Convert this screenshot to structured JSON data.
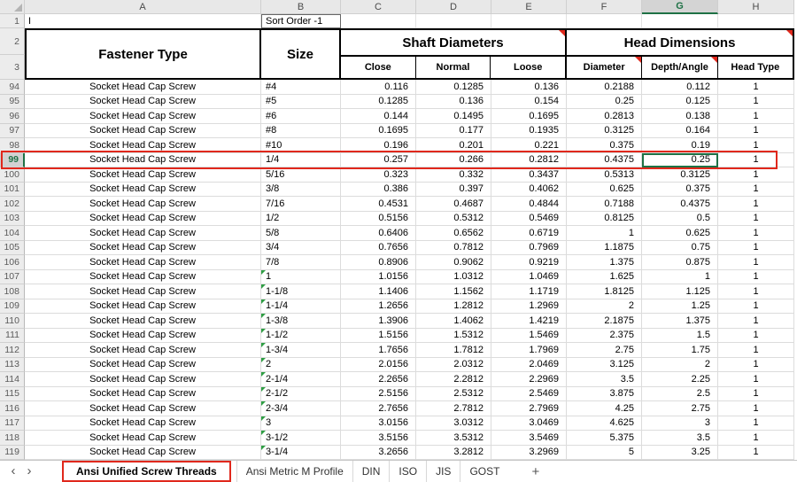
{
  "colors": {
    "selection_green": "#1e7145",
    "annotation_red": "#e0281c",
    "error_flag_green": "#2f9e44",
    "header_gray": "#e8e8e8"
  },
  "sheet": {
    "col_letters": [
      "A",
      "B",
      "C",
      "D",
      "E",
      "F",
      "G",
      "H"
    ],
    "row_numbers": {
      "r1": "1",
      "r2": "2",
      "r3": "3"
    },
    "row1": {
      "a1": "I",
      "b1": "Sort Order -1"
    },
    "headers": {
      "fastener_type": "Fastener Type",
      "size": "Size",
      "shaft": "Shaft Diameters",
      "head": "Head Dimensions",
      "close": "Close",
      "normal": "Normal",
      "loose": "Loose",
      "diameter": "Diameter",
      "depth": "Depth/Angle",
      "head_type": "Head Type"
    },
    "selection": {
      "row": 99,
      "column_letter": "G"
    },
    "rows": [
      {
        "n": 94,
        "type": "Socket Head Cap Screw",
        "size": "#4",
        "close": "0.116",
        "normal": "0.1285",
        "loose": "0.136",
        "diameter": "0.2188",
        "depth": "0.112",
        "head_type": "1",
        "flag": false
      },
      {
        "n": 95,
        "type": "Socket Head Cap Screw",
        "size": "#5",
        "close": "0.1285",
        "normal": "0.136",
        "loose": "0.154",
        "diameter": "0.25",
        "depth": "0.125",
        "head_type": "1",
        "flag": false
      },
      {
        "n": 96,
        "type": "Socket Head Cap Screw",
        "size": "#6",
        "close": "0.144",
        "normal": "0.1495",
        "loose": "0.1695",
        "diameter": "0.2813",
        "depth": "0.138",
        "head_type": "1",
        "flag": false
      },
      {
        "n": 97,
        "type": "Socket Head Cap Screw",
        "size": "#8",
        "close": "0.1695",
        "normal": "0.177",
        "loose": "0.1935",
        "diameter": "0.3125",
        "depth": "0.164",
        "head_type": "1",
        "flag": false
      },
      {
        "n": 98,
        "type": "Socket Head Cap Screw",
        "size": "#10",
        "close": "0.196",
        "normal": "0.201",
        "loose": "0.221",
        "diameter": "0.375",
        "depth": "0.19",
        "head_type": "1",
        "flag": false
      },
      {
        "n": 99,
        "type": "Socket Head Cap Screw",
        "size": "1/4",
        "close": "0.257",
        "normal": "0.266",
        "loose": "0.2812",
        "diameter": "0.4375",
        "depth": "0.25",
        "head_type": "1",
        "flag": false
      },
      {
        "n": 100,
        "type": "Socket Head Cap Screw",
        "size": "5/16",
        "close": "0.323",
        "normal": "0.332",
        "loose": "0.3437",
        "diameter": "0.5313",
        "depth": "0.3125",
        "head_type": "1",
        "flag": false
      },
      {
        "n": 101,
        "type": "Socket Head Cap Screw",
        "size": "3/8",
        "close": "0.386",
        "normal": "0.397",
        "loose": "0.4062",
        "diameter": "0.625",
        "depth": "0.375",
        "head_type": "1",
        "flag": false
      },
      {
        "n": 102,
        "type": "Socket Head Cap Screw",
        "size": "7/16",
        "close": "0.4531",
        "normal": "0.4687",
        "loose": "0.4844",
        "diameter": "0.7188",
        "depth": "0.4375",
        "head_type": "1",
        "flag": false
      },
      {
        "n": 103,
        "type": "Socket Head Cap Screw",
        "size": "1/2",
        "close": "0.5156",
        "normal": "0.5312",
        "loose": "0.5469",
        "diameter": "0.8125",
        "depth": "0.5",
        "head_type": "1",
        "flag": false
      },
      {
        "n": 104,
        "type": "Socket Head Cap Screw",
        "size": "5/8",
        "close": "0.6406",
        "normal": "0.6562",
        "loose": "0.6719",
        "diameter": "1",
        "depth": "0.625",
        "head_type": "1",
        "flag": false
      },
      {
        "n": 105,
        "type": "Socket Head Cap Screw",
        "size": "3/4",
        "close": "0.7656",
        "normal": "0.7812",
        "loose": "0.7969",
        "diameter": "1.1875",
        "depth": "0.75",
        "head_type": "1",
        "flag": false
      },
      {
        "n": 106,
        "type": "Socket Head Cap Screw",
        "size": "7/8",
        "close": "0.8906",
        "normal": "0.9062",
        "loose": "0.9219",
        "diameter": "1.375",
        "depth": "0.875",
        "head_type": "1",
        "flag": false
      },
      {
        "n": 107,
        "type": "Socket Head Cap Screw",
        "size": "1",
        "close": "1.0156",
        "normal": "1.0312",
        "loose": "1.0469",
        "diameter": "1.625",
        "depth": "1",
        "head_type": "1",
        "flag": true
      },
      {
        "n": 108,
        "type": "Socket Head Cap Screw",
        "size": "1-1/8",
        "close": "1.1406",
        "normal": "1.1562",
        "loose": "1.1719",
        "diameter": "1.8125",
        "depth": "1.125",
        "head_type": "1",
        "flag": true
      },
      {
        "n": 109,
        "type": "Socket Head Cap Screw",
        "size": "1-1/4",
        "close": "1.2656",
        "normal": "1.2812",
        "loose": "1.2969",
        "diameter": "2",
        "depth": "1.25",
        "head_type": "1",
        "flag": true
      },
      {
        "n": 110,
        "type": "Socket Head Cap Screw",
        "size": "1-3/8",
        "close": "1.3906",
        "normal": "1.4062",
        "loose": "1.4219",
        "diameter": "2.1875",
        "depth": "1.375",
        "head_type": "1",
        "flag": true
      },
      {
        "n": 111,
        "type": "Socket Head Cap Screw",
        "size": "1-1/2",
        "close": "1.5156",
        "normal": "1.5312",
        "loose": "1.5469",
        "diameter": "2.375",
        "depth": "1.5",
        "head_type": "1",
        "flag": true
      },
      {
        "n": 112,
        "type": "Socket Head Cap Screw",
        "size": "1-3/4",
        "close": "1.7656",
        "normal": "1.7812",
        "loose": "1.7969",
        "diameter": "2.75",
        "depth": "1.75",
        "head_type": "1",
        "flag": true
      },
      {
        "n": 113,
        "type": "Socket Head Cap Screw",
        "size": "2",
        "close": "2.0156",
        "normal": "2.0312",
        "loose": "2.0469",
        "diameter": "3.125",
        "depth": "2",
        "head_type": "1",
        "flag": true
      },
      {
        "n": 114,
        "type": "Socket Head Cap Screw",
        "size": "2-1/4",
        "close": "2.2656",
        "normal": "2.2812",
        "loose": "2.2969",
        "diameter": "3.5",
        "depth": "2.25",
        "head_type": "1",
        "flag": true
      },
      {
        "n": 115,
        "type": "Socket Head Cap Screw",
        "size": "2-1/2",
        "close": "2.5156",
        "normal": "2.5312",
        "loose": "2.5469",
        "diameter": "3.875",
        "depth": "2.5",
        "head_type": "1",
        "flag": true
      },
      {
        "n": 116,
        "type": "Socket Head Cap Screw",
        "size": "2-3/4",
        "close": "2.7656",
        "normal": "2.7812",
        "loose": "2.7969",
        "diameter": "4.25",
        "depth": "2.75",
        "head_type": "1",
        "flag": true
      },
      {
        "n": 117,
        "type": "Socket Head Cap Screw",
        "size": "3",
        "close": "3.0156",
        "normal": "3.0312",
        "loose": "3.0469",
        "diameter": "4.625",
        "depth": "3",
        "head_type": "1",
        "flag": true
      },
      {
        "n": 118,
        "type": "Socket Head Cap Screw",
        "size": "3-1/2",
        "close": "3.5156",
        "normal": "3.5312",
        "loose": "3.5469",
        "diameter": "5.375",
        "depth": "3.5",
        "head_type": "1",
        "flag": true
      },
      {
        "n": 119,
        "type": "Socket Head Cap Screw",
        "size": "3-1/4",
        "close": "3.2656",
        "normal": "3.2812",
        "loose": "3.2969",
        "diameter": "5",
        "depth": "3.25",
        "head_type": "1",
        "flag": true
      }
    ]
  },
  "tabs": {
    "items": [
      {
        "label": "Ansi Unified Screw Threads",
        "active": true
      },
      {
        "label": "Ansi Metric M Profile",
        "active": false
      },
      {
        "label": "DIN",
        "active": false
      },
      {
        "label": "ISO",
        "active": false
      },
      {
        "label": "JIS",
        "active": false
      },
      {
        "label": "GOST",
        "active": false
      }
    ],
    "add_label": "+"
  }
}
